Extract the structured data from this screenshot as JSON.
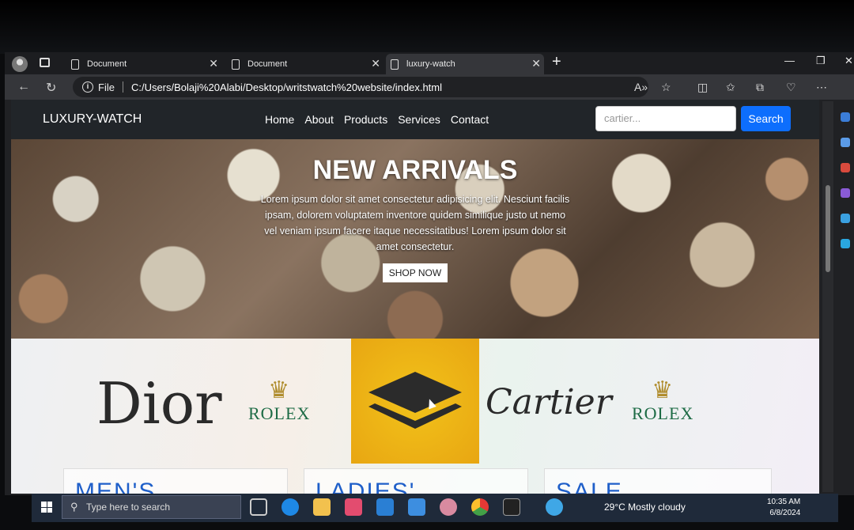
{
  "browser": {
    "tabs": [
      {
        "title": "Document"
      },
      {
        "title": "Document"
      },
      {
        "title": "luxury-watch"
      }
    ],
    "address_file_label": "File",
    "url": "C:/Users/Bolaji%20Alabi/Desktop/writstwatch%20website/index.html"
  },
  "site": {
    "brand": "LUXURY-WATCH",
    "menu": [
      "Home",
      "About",
      "Products",
      "Services",
      "Contact"
    ],
    "search_value": "cartier...",
    "search_button": "Search"
  },
  "hero": {
    "title": "NEW ARRIVALS",
    "text": "Lorem ipsum dolor sit amet consectetur adipisicing elit. Nesciunt facilis ipsam, dolorem voluptatem inventore quidem similique justo ut nemo vel veniam ipsum facere itaque necessitatibus! Lorem ipsum dolor sit amet consectetur.",
    "button": "SHOP NOW"
  },
  "brands": {
    "dior": "Dior",
    "rolex_1": "ROLEX",
    "cartier": "Cartier",
    "rolex_2": "ROLEX"
  },
  "cards": [
    "MEN'S",
    "LADIES'",
    "SALE"
  ],
  "taskbar": {
    "search_placeholder": "Type here to search",
    "weather": "29°C  Mostly cloudy",
    "time": "10:35 AM",
    "date": "6/8/2024"
  }
}
